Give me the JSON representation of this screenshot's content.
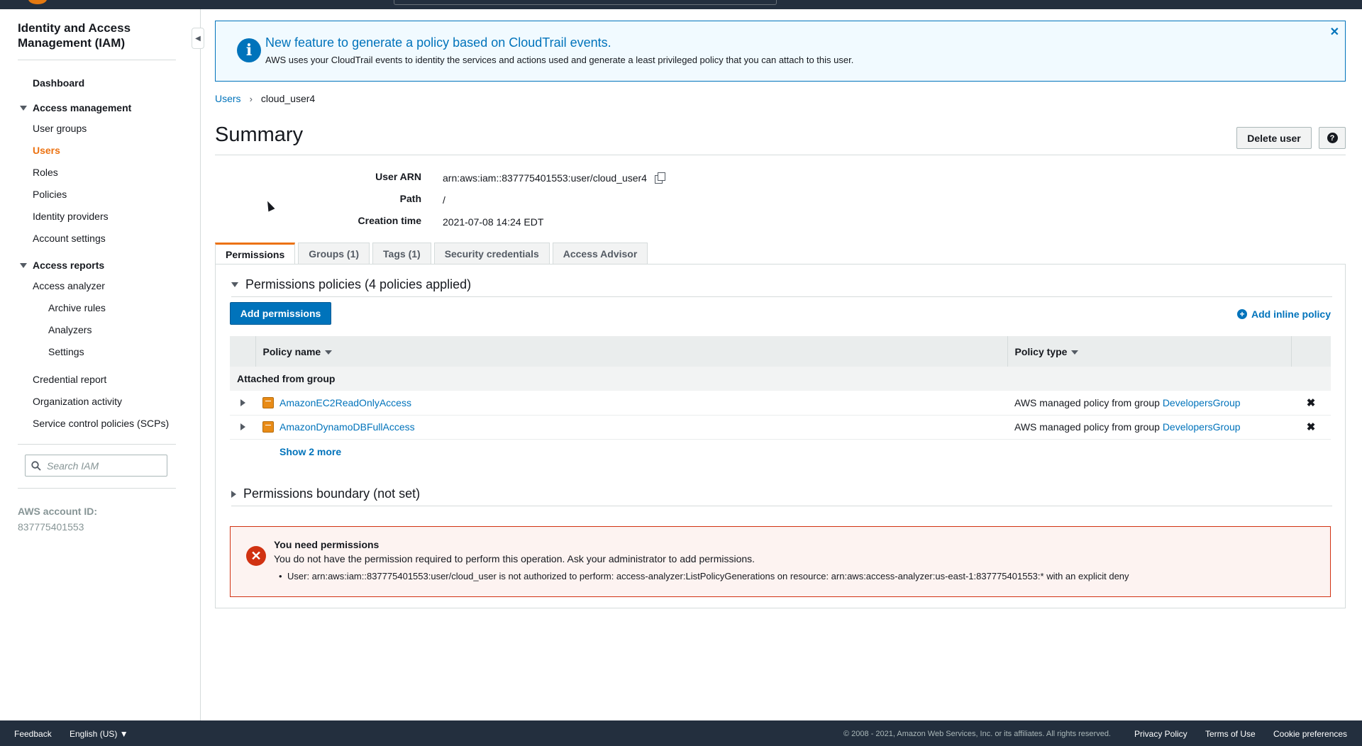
{
  "sidebar": {
    "title": "Identity and Access Management (IAM)",
    "dashboard": "Dashboard",
    "access_management": "Access management",
    "user_groups": "User groups",
    "users": "Users",
    "roles": "Roles",
    "policies": "Policies",
    "identity_providers": "Identity providers",
    "account_settings": "Account settings",
    "access_reports": "Access reports",
    "access_analyzer": "Access analyzer",
    "archive_rules": "Archive rules",
    "analyzers": "Analyzers",
    "settings": "Settings",
    "credential_report": "Credential report",
    "organization_activity": "Organization activity",
    "scps": "Service control policies (SCPs)",
    "search_placeholder": "Search IAM",
    "account_label": "AWS account ID:",
    "account_id": "837775401553"
  },
  "banner": {
    "title": "New feature to generate a policy based on CloudTrail events.",
    "text": "AWS uses your CloudTrail events to identity the services and actions used and generate a least privileged policy that you can attach to this user.",
    "close": "✕"
  },
  "breadcrumb": {
    "users": "Users",
    "separator": "›",
    "current": "cloud_user4"
  },
  "summary": {
    "title": "Summary",
    "delete_button": "Delete user",
    "help": "?",
    "user_arn_label": "User ARN",
    "user_arn": "arn:aws:iam::837775401553:user/cloud_user4",
    "path_label": "Path",
    "path": "/",
    "creation_label": "Creation time",
    "creation_time": "2021-07-08 14:24 EDT"
  },
  "tabs": [
    "Permissions",
    "Groups (1)",
    "Tags (1)",
    "Security credentials",
    "Access Advisor"
  ],
  "permissions": {
    "policies_header": "Permissions policies (4 policies applied)",
    "add_permissions": "Add permissions",
    "add_inline_policy": "Add inline policy",
    "columns": {
      "policy_name": "Policy name",
      "policy_type": "Policy type"
    },
    "group_label": "Attached from group",
    "rows": [
      {
        "name": "AmazonEC2ReadOnlyAccess",
        "type_prefix": "AWS managed policy from group",
        "group": "DevelopersGroup"
      },
      {
        "name": "AmazonDynamoDBFullAccess",
        "type_prefix": "AWS managed policy from group",
        "group": "DevelopersGroup"
      }
    ],
    "show_more": "Show 2 more",
    "boundary_header": "Permissions boundary (not set)"
  },
  "error": {
    "title": "You need permissions",
    "text": "You do not have the permission required to perform this operation. Ask your administrator to add permissions.",
    "detail": "User: arn:aws:iam::837775401553:user/cloud_user is not authorized to perform: access-analyzer:ListPolicyGenerations on resource: arn:aws:access-analyzer:us-east-1:837775401553:* with an explicit deny"
  },
  "footer": {
    "feedback": "Feedback",
    "language": "English (US) ▼",
    "copyright": "© 2008 - 2021, Amazon Web Services, Inc. or its affiliates. All rights reserved.",
    "privacy": "Privacy Policy",
    "terms": "Terms of Use",
    "cookies": "Cookie preferences"
  },
  "colors": {
    "accent": "#ec7211",
    "link": "#0073bb",
    "error": "#d13212",
    "nav_dark": "#232f3e"
  }
}
